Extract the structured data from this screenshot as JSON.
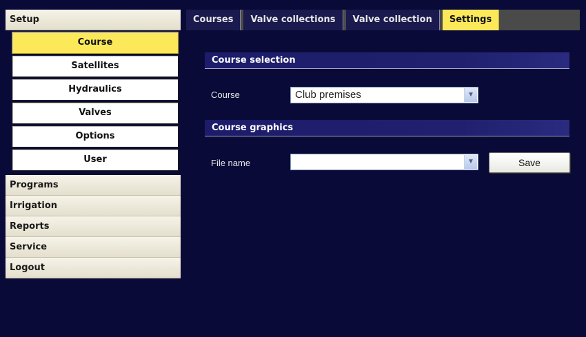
{
  "sidebar": {
    "header": "Setup",
    "setup_items": [
      {
        "label": "Course",
        "active": true
      },
      {
        "label": "Satellites"
      },
      {
        "label": "Hydraulics"
      },
      {
        "label": "Valves"
      },
      {
        "label": "Options"
      },
      {
        "label": "User"
      }
    ],
    "sections": [
      "Programs",
      "Irrigation",
      "Reports",
      "Service",
      "Logout"
    ]
  },
  "tabs": [
    {
      "label": "Courses"
    },
    {
      "label": "Valve collections"
    },
    {
      "label": "Valve collection"
    },
    {
      "label": "Settings",
      "active": true
    }
  ],
  "main": {
    "course_selection": {
      "title": "Course selection",
      "course_label": "Course",
      "course_value": "Club premises"
    },
    "course_graphics": {
      "title": "Course graphics",
      "file_label": "File name",
      "file_value": "",
      "save_label": "Save"
    }
  },
  "colors": {
    "background": "#0a0a38",
    "active_yellow": "#fbe95a",
    "section_bar": "#1c1c6a"
  },
  "icons": {
    "dropdown": "chevron-down-icon"
  }
}
